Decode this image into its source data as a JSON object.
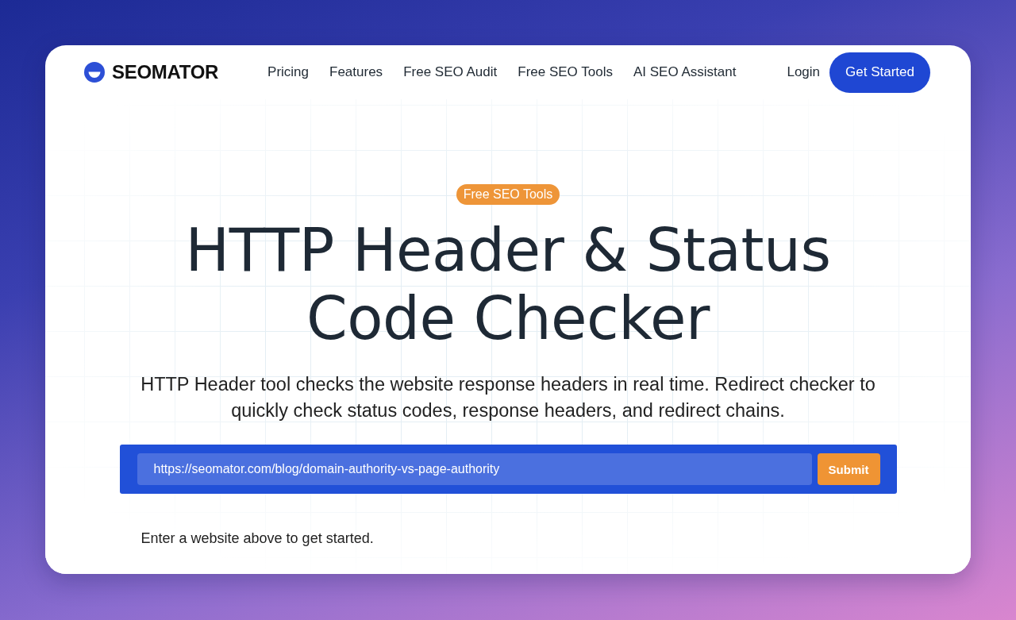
{
  "logo": {
    "text": "SEOMATOR"
  },
  "nav": {
    "links": [
      "Pricing",
      "Features",
      "Free SEO Audit",
      "Free SEO Tools",
      "AI SEO Assistant"
    ],
    "login": "Login",
    "cta": "Get Started"
  },
  "hero": {
    "badge": "Free SEO Tools",
    "title_lines": [
      "HTTP Header & Status",
      "Code Checker"
    ],
    "description": "HTTP Header tool checks the website response headers in real time. Redirect checker to quickly check status codes, response headers, and redirect chains."
  },
  "search": {
    "value": "https://seomator.com/blog/domain-authority-vs-page-authority",
    "button": "Submit"
  },
  "hint": "Enter a website above to get started."
}
